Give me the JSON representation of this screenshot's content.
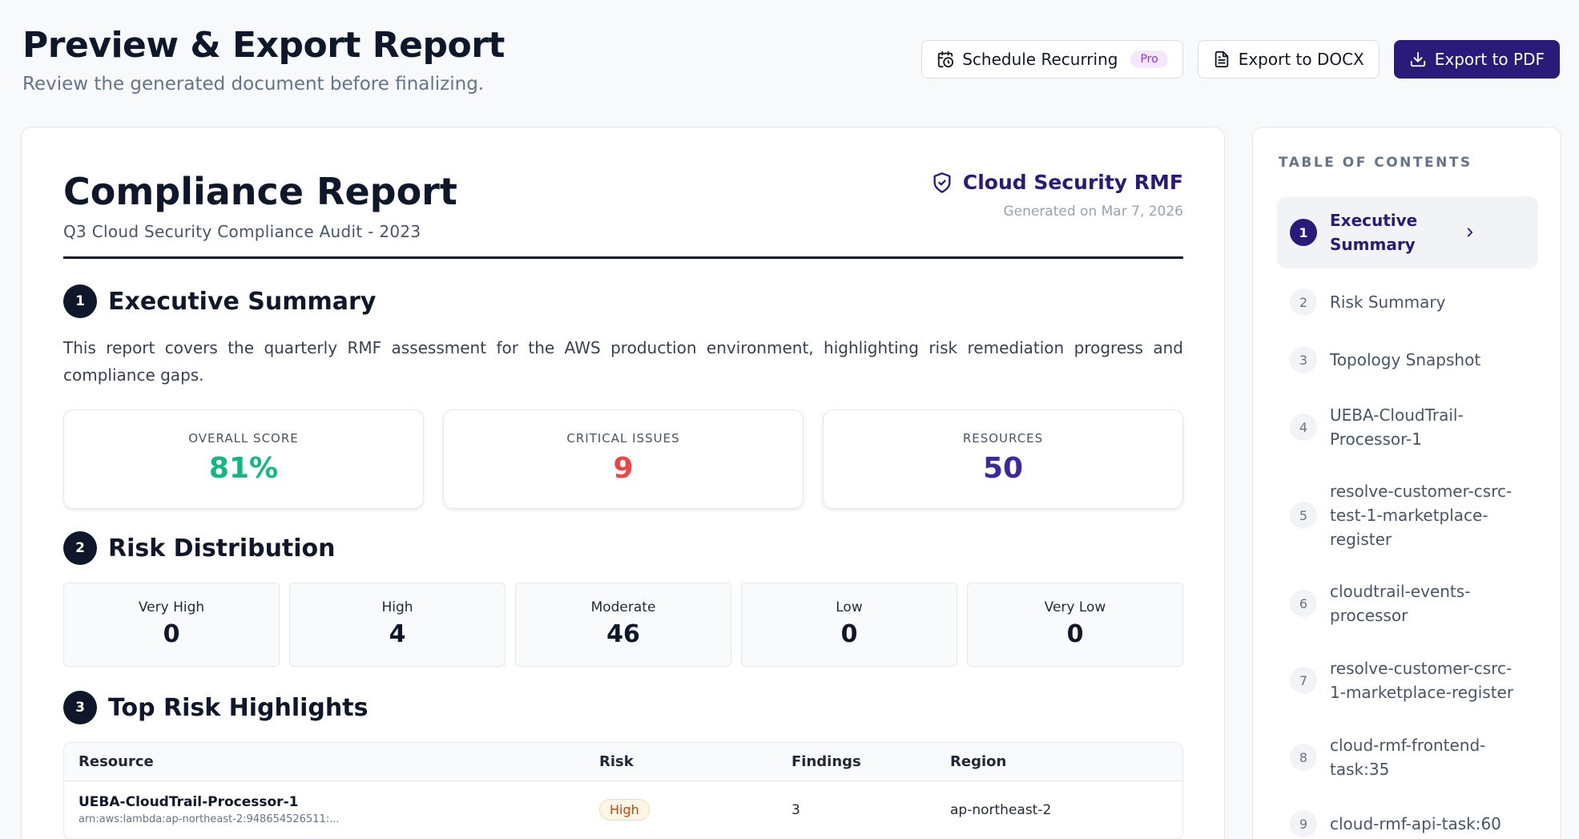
{
  "header": {
    "title": "Preview & Export Report",
    "subtitle": "Review the generated document before finalizing.",
    "schedule_label": "Schedule Recurring",
    "pro_badge": "Pro",
    "docx_label": "Export to DOCX",
    "pdf_label": "Export to PDF"
  },
  "report": {
    "title": "Compliance Report",
    "subtitle": "Q3 Cloud Security Compliance Audit - 2023",
    "brand": "Cloud Security RMF",
    "generated": "Generated on Mar 7, 2026"
  },
  "sections": {
    "executive": {
      "num": "1",
      "title": "Executive Summary",
      "text": "This report covers the quarterly RMF assessment for the AWS production environment, highlighting risk remediation progress and compliance gaps.",
      "stats": [
        {
          "label": "OVERALL SCORE",
          "value": "81%",
          "color": "#10b981"
        },
        {
          "label": "CRITICAL ISSUES",
          "value": "9",
          "color": "#ef4444"
        },
        {
          "label": "RESOURCES",
          "value": "50",
          "color": "#3b2a9e"
        }
      ]
    },
    "risk": {
      "num": "2",
      "title": "Risk Distribution",
      "levels": [
        {
          "label": "Very High",
          "value": "0"
        },
        {
          "label": "High",
          "value": "4"
        },
        {
          "label": "Moderate",
          "value": "46"
        },
        {
          "label": "Low",
          "value": "0"
        },
        {
          "label": "Very Low",
          "value": "0"
        }
      ]
    },
    "highlights": {
      "num": "3",
      "title": "Top Risk Highlights",
      "columns": [
        "Resource",
        "Risk",
        "Findings",
        "Region"
      ],
      "rows": [
        {
          "name": "UEBA-CloudTrail-Processor-1",
          "arn": "arn:aws:lambda:ap-northeast-2:948654526511:...",
          "risk": "High",
          "findings": "3",
          "region": "ap-northeast-2"
        }
      ]
    }
  },
  "toc": {
    "title": "TABLE OF CONTENTS",
    "items": [
      {
        "num": "1",
        "label": "Executive Summary"
      },
      {
        "num": "2",
        "label": "Risk Summary"
      },
      {
        "num": "3",
        "label": "Topology Snapshot"
      },
      {
        "num": "4",
        "label": "UEBA-CloudTrail-Processor-1"
      },
      {
        "num": "5",
        "label": "resolve-customer-csrc-test-1-marketplace-register"
      },
      {
        "num": "6",
        "label": "cloudtrail-events-processor"
      },
      {
        "num": "7",
        "label": "resolve-customer-csrc-1-marketplace-register"
      },
      {
        "num": "8",
        "label": "cloud-rmf-frontend-task:35"
      },
      {
        "num": "9",
        "label": "cloud-rmf-api-task:60"
      }
    ]
  },
  "colors": {
    "primary": "#2a1a7a",
    "score": "#10b981",
    "critical": "#ef4444",
    "resources": "#3b2a9e"
  }
}
